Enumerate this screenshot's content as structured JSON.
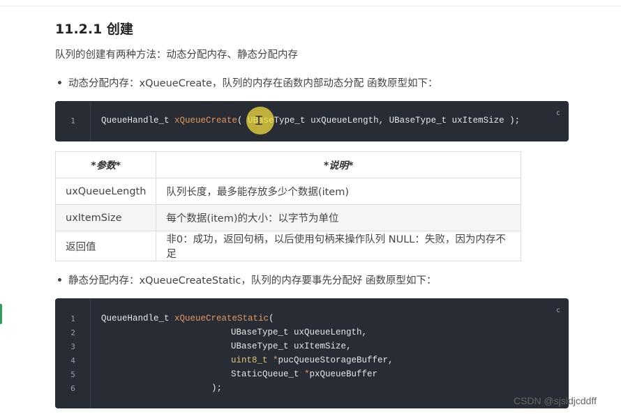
{
  "heading": "11.2.1 创建",
  "intro": "队列的创建有两种方法：动态分配内存、静态分配内存",
  "dynamic": {
    "bullet": "动态分配内存：xQueueCreate，队列的内存在函数内部动态分配 函数原型如下：",
    "copy_label": "c",
    "code": {
      "line_no": "1",
      "type": "QueueHandle_t ",
      "fn": "xQueueCreate",
      "args": "( UBaseType_t uxQueueLength, UBaseType_t uxItemSize );"
    }
  },
  "table": {
    "headers": [
      "*参数*",
      "*说明*"
    ],
    "rows": [
      [
        "uxQueueLength",
        "队列长度，最多能存放多少个数据(item)"
      ],
      [
        "uxItemSize",
        "每个数据(item)的大小：以字节为单位"
      ],
      [
        "返回值",
        "非0：成功，返回句柄，以后使用句柄来操作队列 NULL：失败，因为内存不足"
      ]
    ]
  },
  "static": {
    "bullet": "静态分配内存：xQueueCreateStatic，队列的内存要事先分配好 函数原型如下：",
    "copy_label": "c",
    "line_numbers": [
      "1",
      "2",
      "3",
      "4",
      "5",
      "6"
    ],
    "code": {
      "l1_type": "QueueHandle_t ",
      "l1_fn": "xQueueCreateStatic",
      "l1_rest": "(",
      "l2": "UBaseType_t uxQueueLength,",
      "l3": "UBaseType_t uxItemSize,",
      "l4_kw": "uint8_t",
      "l4_ptr": " *",
      "l4_rest": "pucQueueStorageBuffer,",
      "l5_type": "StaticQueue_t",
      "l5_ptr": " *",
      "l5_rest": "pxQueueBuffer",
      "l6": ");"
    }
  },
  "watermark": "CSDN @sjsidjcddff",
  "colors": {
    "code_bg": "#282c34",
    "function_name": "#e5975c",
    "keyword": "#e5c07b",
    "cursor_highlight": "#f0dc3c",
    "left_marker": "#2e9e5b"
  }
}
